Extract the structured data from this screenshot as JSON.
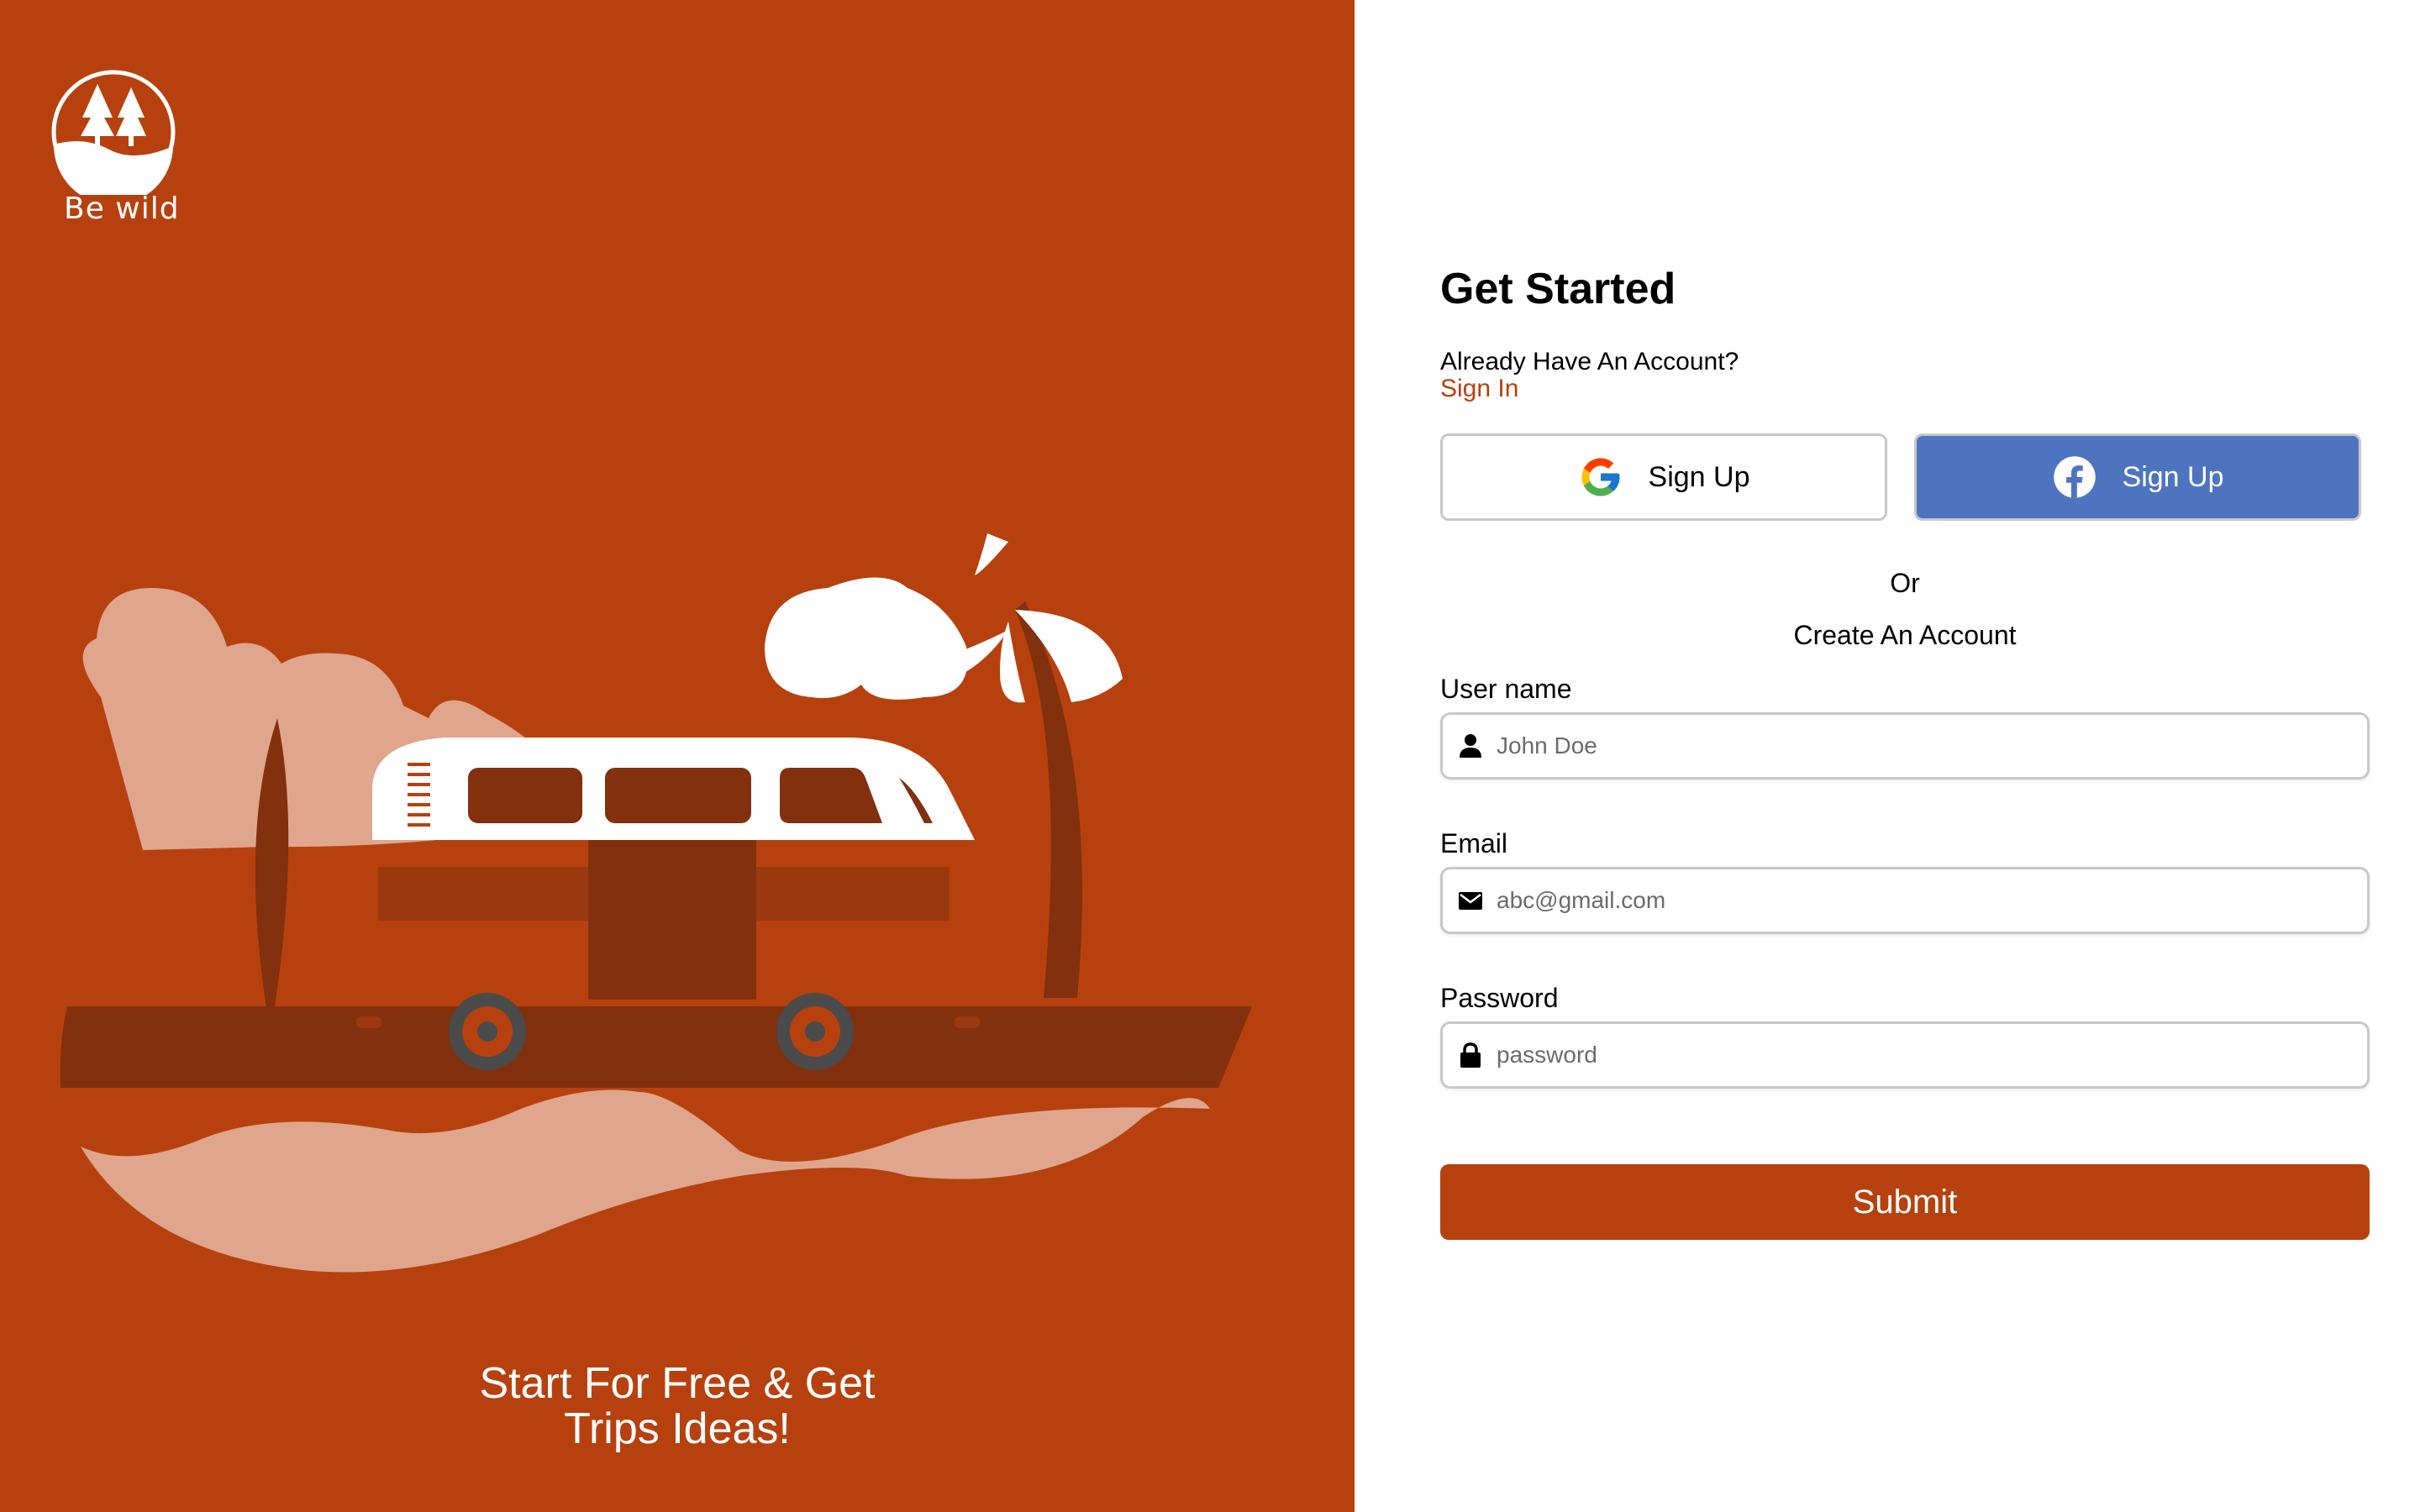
{
  "brand": {
    "name": "Be wild"
  },
  "hero": {
    "tagline_line1": "Start For Free & Get",
    "tagline_line2": "Trips Ideas!"
  },
  "form": {
    "title": "Get Started",
    "already_text": "Already Have An Account?",
    "signin_link": "Sign In",
    "google_label": "Sign Up",
    "facebook_label": "Sign Up",
    "or_text": "Or",
    "create_text": "Create An Account",
    "username": {
      "label": "User name",
      "placeholder": "John Doe",
      "icon": "user-icon"
    },
    "email": {
      "label": "Email",
      "placeholder": "abc@gmail.com",
      "icon": "envelope-icon"
    },
    "password": {
      "label": "Password",
      "placeholder": "password",
      "icon": "lock-icon"
    },
    "submit_label": "Submit"
  },
  "colors": {
    "accent": "#b7410e",
    "facebook": "#4f74bf",
    "background": "#ffffff"
  }
}
